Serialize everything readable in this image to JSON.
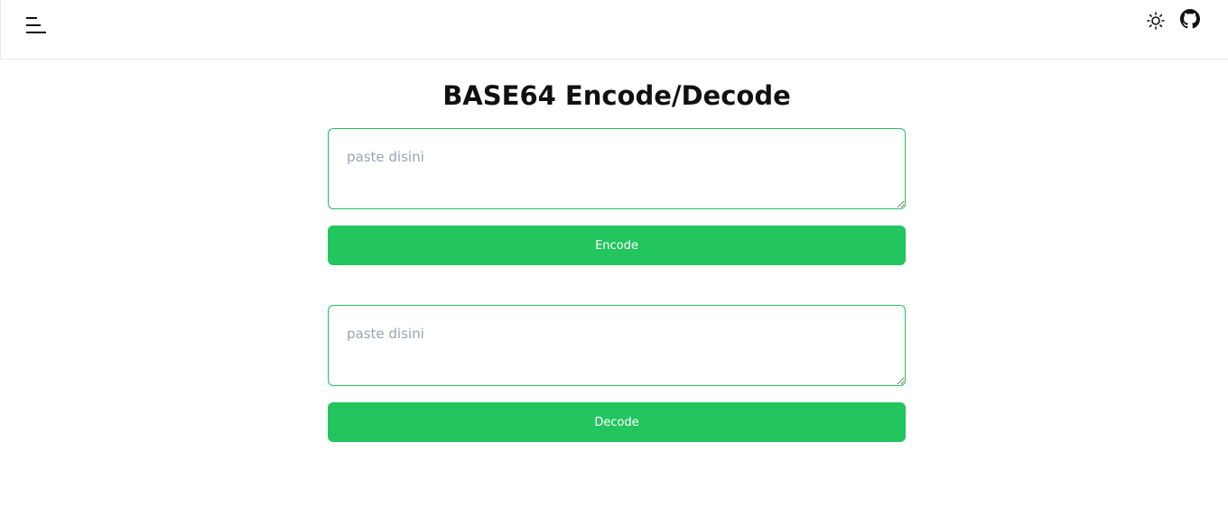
{
  "header": {
    "menu_icon": "hamburger-menu-icon",
    "theme_icon": "sun-icon",
    "github_icon": "github-icon"
  },
  "main": {
    "title": "BASE64 Encode/Decode",
    "encode": {
      "placeholder": "paste disini",
      "value": "",
      "button_label": "Encode"
    },
    "decode": {
      "placeholder": "paste disini",
      "value": "",
      "button_label": "Decode"
    }
  },
  "colors": {
    "accent": "#22c55e",
    "button_text": "#ffffff",
    "border": "#e5e7eb",
    "placeholder": "#9ca3af"
  }
}
